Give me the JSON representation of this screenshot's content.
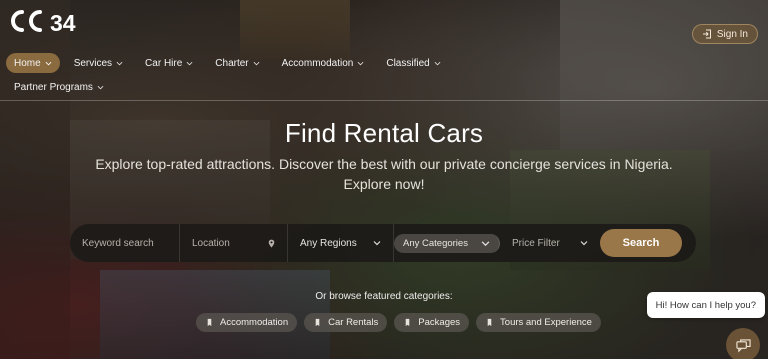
{
  "brand": {
    "logo_text": "CE34",
    "accent": "#8a6a3f"
  },
  "header": {
    "signin_label": "Sign In"
  },
  "nav": {
    "items": [
      {
        "label": "Home",
        "active": true
      },
      {
        "label": "Services"
      },
      {
        "label": "Car Hire"
      },
      {
        "label": "Charter"
      },
      {
        "label": "Accommodation"
      },
      {
        "label": "Classified"
      },
      {
        "label": "Partner Programs"
      }
    ]
  },
  "hero": {
    "title": "Find Rental Cars",
    "subtitle": "Explore top-rated attractions. Discover the best with our private concierge services in Nigeria. Explore now!"
  },
  "search": {
    "keyword_placeholder": "Keyword search",
    "location_placeholder": "Location",
    "regions_label": "Any Regions",
    "categories_label": "Any Categories",
    "price_label": "Price Filter",
    "button_label": "Search"
  },
  "browse": {
    "label": "Or browse featured categories:",
    "categories": [
      "Accommodation",
      "Car Rentals",
      "Packages",
      "Tours and Experience"
    ]
  },
  "chat": {
    "bubble_text": "Hi! How can I help you?"
  }
}
